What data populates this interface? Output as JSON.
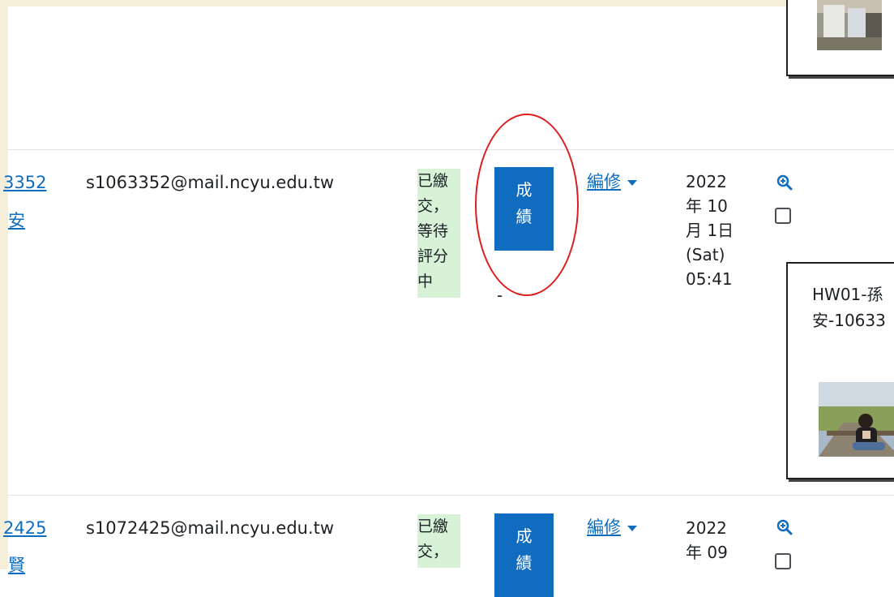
{
  "rows": [
    {
      "id_link": "3352",
      "name_link": "安",
      "email": "s1063352@mail.ncyu.edu.tw",
      "status_lines": [
        "已繳",
        "交，",
        "等待",
        "評分",
        "中"
      ],
      "grade_button_lines": [
        "成",
        "績"
      ],
      "grade_value": "-",
      "edit_label": "編修",
      "date_lines": [
        "2022",
        "年 10",
        "月 1日",
        "(Sat)",
        "05:41"
      ],
      "file_name_lines": [
        "HW01-孫",
        "安-10633"
      ]
    },
    {
      "id_link": "2425",
      "name_link": "賢",
      "email": "s1072425@mail.ncyu.edu.tw",
      "status_lines": [
        "已繳",
        "交，"
      ],
      "grade_button_lines": [
        "成",
        "績"
      ],
      "edit_label": "編修",
      "date_lines": [
        "2022",
        "年 09"
      ]
    }
  ],
  "icons": {
    "zoom": "zoom-in-icon",
    "caret": "chevron-down-icon"
  },
  "colors": {
    "link": "#0f6cbf",
    "status_bg": "#d7f2d7",
    "button": "#0f6cbf",
    "annotation": "#dd1c1c"
  }
}
